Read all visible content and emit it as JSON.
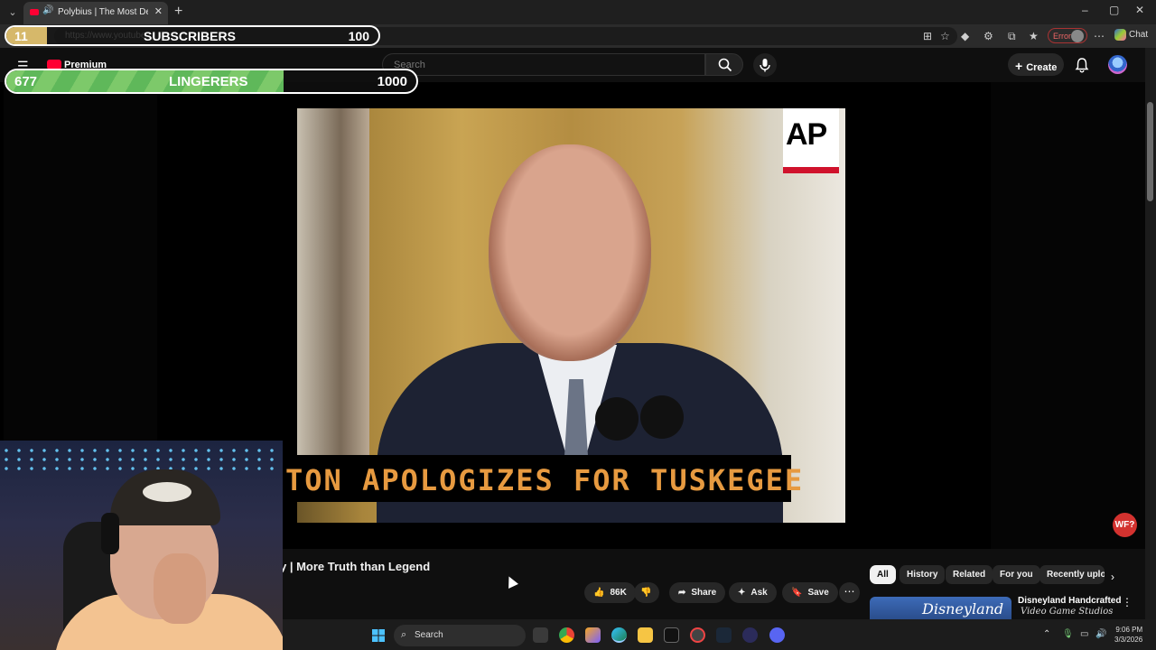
{
  "browser": {
    "tab_title": "Polybius | The Most Deadly V",
    "new_tab": "+",
    "url": "https://www.youtube",
    "error_label": "Error",
    "chat_label": "Chat",
    "window_controls": [
      "–",
      "▢",
      "✕"
    ]
  },
  "youtube": {
    "brand": "Premium",
    "search_placeholder": "Search",
    "create_label": "Create"
  },
  "overlays": {
    "subscribers": {
      "label": "SUBSCRIBERS",
      "left": "11",
      "target": "100",
      "progress": 0.11
    },
    "lingerers": {
      "label": "LINGERERS",
      "left": "677",
      "target": "1000",
      "progress": 0.677
    }
  },
  "video": {
    "lower_third": "TON APOLOGIZES FOR TUSKEGEE",
    "news_logo": "AP",
    "title_visible": "y | More Truth than Legend",
    "badge": "WF?"
  },
  "actions": {
    "like_count": "86K",
    "share_label": "Share",
    "ask_label": "Ask",
    "save_label": "Save"
  },
  "chips": [
    {
      "label": "All",
      "active": true
    },
    {
      "label": "History",
      "active": false
    },
    {
      "label": "Related",
      "active": false
    },
    {
      "label": "For you",
      "active": false
    },
    {
      "label": "Recently uplo",
      "active": false
    }
  ],
  "recommendation": {
    "thumb_text": "Disneyland",
    "title": "Disneyland Handcrafted",
    "watermark": "Video Game Studios"
  },
  "taskbar": {
    "search_label": "Search",
    "time": "9:06 PM",
    "date": "3/3/2026"
  },
  "colors": {
    "subscribers_fill": "#d6b86a",
    "lingerers_fill": "#7dc96a",
    "youtube_red": "#ff0033",
    "lower_third_text": "#e79a40"
  }
}
